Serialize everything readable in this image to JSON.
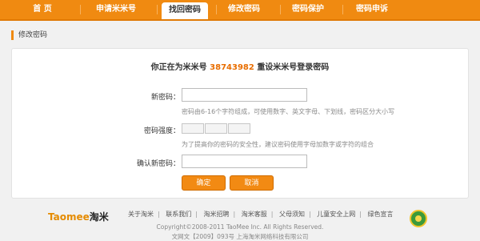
{
  "nav": {
    "items": [
      {
        "label": "首 页"
      },
      {
        "label": "申请米米号"
      },
      {
        "label": "找回密码"
      },
      {
        "label": "修改密码"
      },
      {
        "label": "密码保护"
      },
      {
        "label": "密码申诉"
      }
    ],
    "active_index": 2,
    "accent_color": "#f08a11"
  },
  "page": {
    "title": "修改密码"
  },
  "form": {
    "headline_prefix": "你正在为米米号",
    "account_number": "38743982",
    "headline_suffix": "重设米米号登录密码",
    "new_password_label": "新密码：",
    "new_password_value": "",
    "new_password_hint": "密码由6-16个字符组成，可使用数字、英文字母、下划线，密码区分大小写",
    "strength_label": "密码强度：",
    "strength_hint": "为了提高你的密码的安全性，建议密码使用字母加数字或字符的组合",
    "confirm_label": "确认新密码：",
    "confirm_value": "",
    "submit_label": "确定",
    "cancel_label": "取消"
  },
  "footer": {
    "logo_text": "Taomee",
    "logo_cn": "淘米",
    "links": [
      "关于淘米",
      "联系我们",
      "淘米招聘",
      "淘米客服",
      "父母须知",
      "儿童安全上网",
      "绿色宣言"
    ],
    "copyright": "Copyright©2008-2011 TaoMee Inc. All Rights Reserved.",
    "license": "文网文【2009】093号 上海淘米网络科技有限公司",
    "seal_icon": "green-seal-icon"
  }
}
